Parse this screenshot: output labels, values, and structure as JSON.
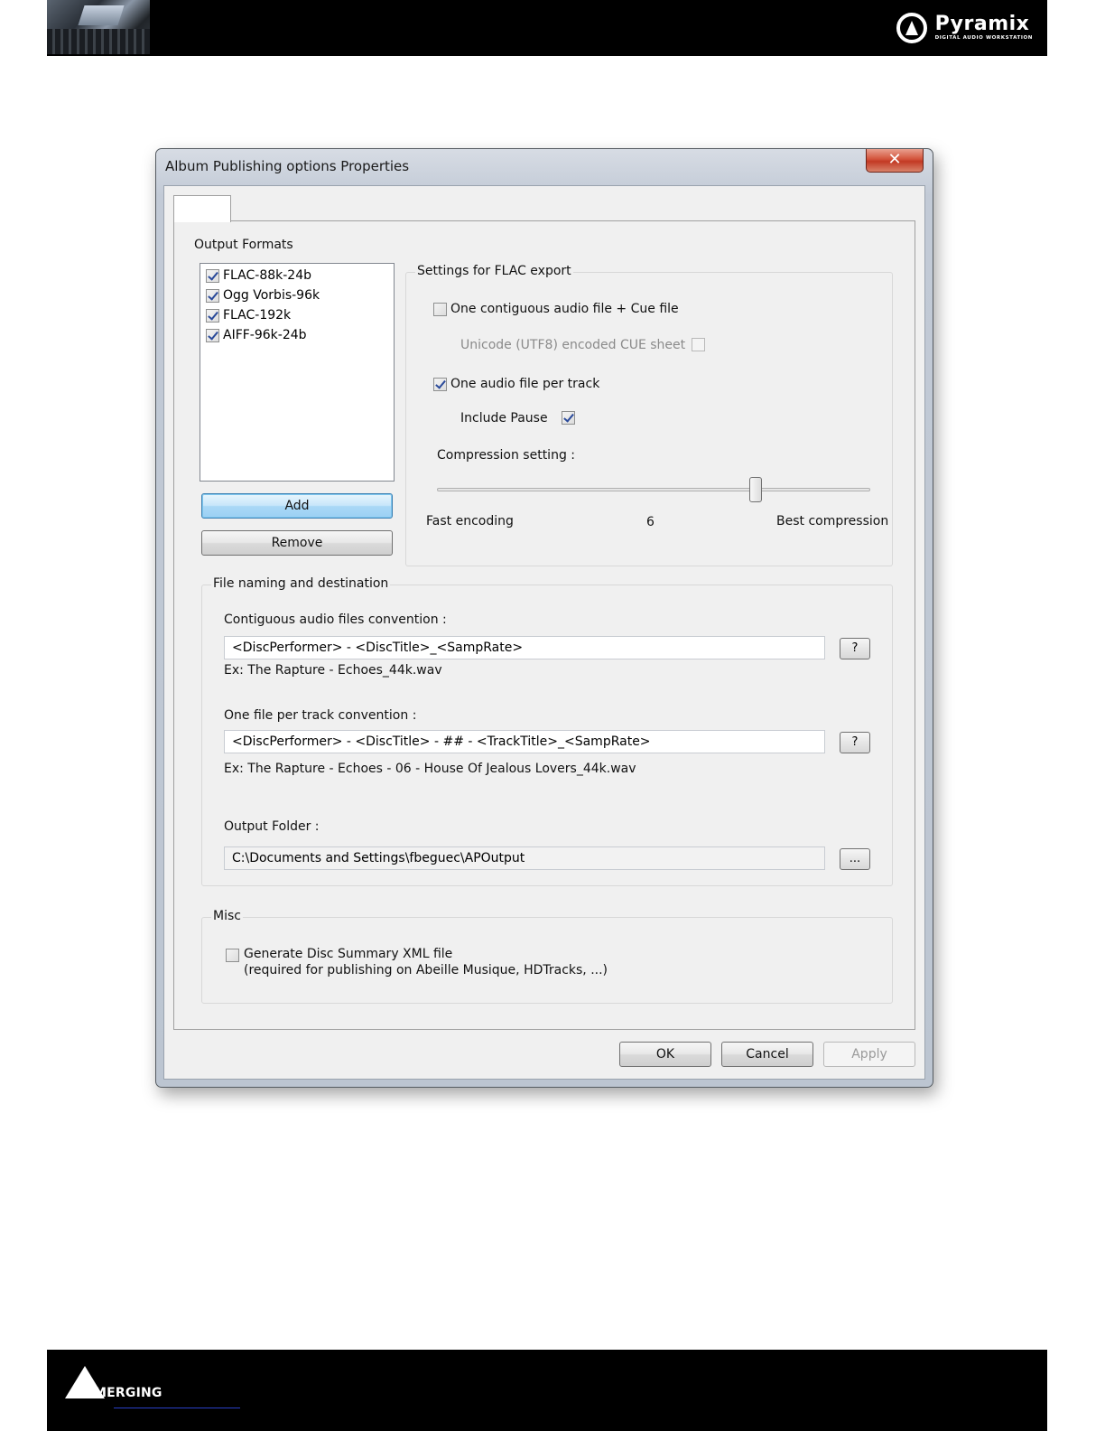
{
  "header": {
    "brand_name": "Pyramix",
    "brand_tagline": "DIGITAL AUDIO WORKSTATION"
  },
  "footer": {
    "brand_name": "MERGING"
  },
  "dialog": {
    "title": "Album Publishing options Properties",
    "close_label": "✕",
    "output_formats": {
      "label": "Output Formats",
      "items": [
        {
          "label": "FLAC-88k-24b",
          "checked": true
        },
        {
          "label": "Ogg Vorbis-96k",
          "checked": true
        },
        {
          "label": "FLAC-192k",
          "checked": true
        },
        {
          "label": "AIFF-96k-24b",
          "checked": true
        }
      ],
      "add_label": "Add",
      "remove_label": "Remove"
    },
    "flac_settings": {
      "title": "Settings for FLAC export",
      "contiguous_label": "One contiguous audio file + Cue file",
      "contiguous_checked": false,
      "unicode_label": "Unicode (UTF8) encoded CUE sheet",
      "unicode_checked": false,
      "per_track_label": "One audio file per track",
      "per_track_checked": true,
      "include_pause_label": "Include Pause",
      "include_pause_checked": true,
      "compression_label": "Compression setting :",
      "compression_value": "6",
      "compression_min": 0,
      "compression_max": 8,
      "fast_label": "Fast encoding",
      "best_label": "Best compression"
    },
    "naming": {
      "title": "File naming and destination",
      "contiguous_convention_label": "Contiguous audio files convention :",
      "contiguous_convention_value": "<DiscPerformer> - <DiscTitle>_<SampRate>",
      "contiguous_example": "Ex: The Rapture - Echoes_44k.wav",
      "per_track_convention_label": "One file per track convention :",
      "per_track_convention_value": "<DiscPerformer> - <DiscTitle> - ## - <TrackTitle>_<SampRate>",
      "per_track_example": "Ex: The Rapture - Echoes - 06 - House Of Jealous Lovers_44k.wav",
      "help_label": "?",
      "output_folder_label": "Output Folder :",
      "output_folder_value": "C:\\Documents and Settings\\fbeguec\\APOutput",
      "browse_label": "..."
    },
    "misc": {
      "title": "Misc",
      "xml_label": "Generate Disc Summary XML file",
      "xml_note": "(required for publishing on Abeille Musique, HDTracks, ...)",
      "xml_checked": false
    },
    "buttons": {
      "ok": "OK",
      "cancel": "Cancel",
      "apply": "Apply"
    }
  }
}
